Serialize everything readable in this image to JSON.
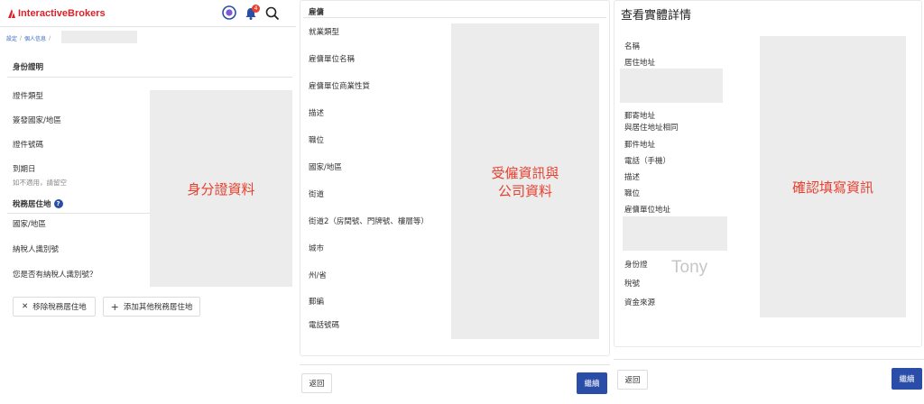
{
  "panel1": {
    "logo_text": "InteractiveBrokers",
    "notification_count": "4",
    "breadcrumb": {
      "item1": "設定",
      "item2": "個人信息"
    },
    "section_id_title": "身份證明",
    "id_fields": [
      "證件類型",
      "簽發國家/地區",
      "證件號碼",
      "到期日"
    ],
    "expiry_hint": "如不適用，請留空",
    "section_tax_title": "稅務居住地",
    "tax_fields": [
      "國家/地區",
      "納稅人識別號",
      "您是否有納稅人識別號？"
    ],
    "remove_button": "移除稅務居住地",
    "add_button": "添加其他稅務居住地",
    "annotation": "身分證資料"
  },
  "panel2": {
    "section_title": "雇傭",
    "fields": [
      "就業類型",
      "雇傭單位名稱",
      "雇傭單位商業性質",
      "描述",
      "職位",
      "國家/地區",
      "街道",
      "街道2（房間號、門牌號、樓層等）",
      "城市",
      "州/省",
      "郵編",
      "電話號碼"
    ],
    "annotation_line1": "受僱資訊與",
    "annotation_line2": "公司資料",
    "back_button": "返回",
    "continue_button": "繼續"
  },
  "panel3": {
    "title": "查看實體詳情",
    "fields_a": [
      "名稱",
      "居住地址"
    ],
    "fields_b": [
      "郵寄地址",
      "與居住地址相同",
      "郵件地址",
      "電話（手機）",
      "描述",
      "職位",
      "雇傭單位地址"
    ],
    "fields_c": [
      "身份證",
      "稅號",
      "資金來源"
    ],
    "name_watermark": "Tony",
    "annotation": "確認填寫資訊",
    "back_button": "返回",
    "continue_button": "繼續"
  }
}
